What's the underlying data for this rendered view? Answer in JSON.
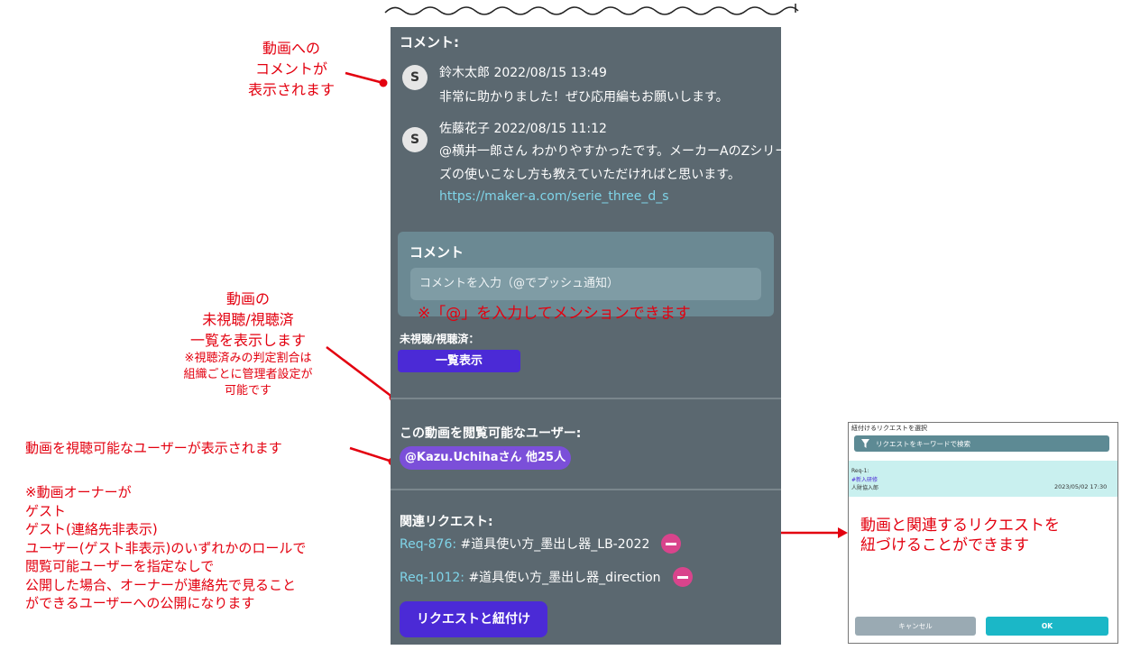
{
  "annotations": {
    "comments_note": [
      "動画への",
      "コメントが",
      "表示されます"
    ],
    "viewed_note": [
      "動画の",
      "未視聴/視聴済",
      "一覧を表示します"
    ],
    "viewed_subnote": [
      "※視聴済みの判定割合は",
      "組織ごとに管理者設定が",
      "可能です"
    ],
    "viewers_note": "動画を視聴可能なユーザーが表示されます",
    "owner_note": [
      "※動画オーナーが",
      "ゲスト",
      "ゲスト(連絡先非表示)",
      "ユーザー(ゲスト非表示)のいずれかのロールで",
      "閲覧可能ユーザーを指定なしで",
      "公開した場合、オーナーが連絡先で見ること",
      "ができるユーザーへの公開になります"
    ],
    "mention_note": "※「@」を入力してメンションできます",
    "link_note": [
      "動画と関連するリクエストを",
      "紐づけることができます"
    ]
  },
  "panel": {
    "comments_header": "コメント:",
    "comments": [
      {
        "avatar": "S",
        "author_time": "鈴木太郎 2022/08/15 13:49",
        "lines": [
          "非常に助かりました！ぜひ応用編もお願いします。"
        ],
        "link": ""
      },
      {
        "avatar": "S",
        "author_time": "佐藤花子 2022/08/15 11:12",
        "lines": [
          "@横井一郎さん わかりやすかったです。メーカーAのZシリー",
          "ズの使いこなし方も教えていただければと思います。"
        ],
        "link": "https://maker-a.com/serie_three_d_s"
      }
    ],
    "comment_box_title": "コメント",
    "comment_placeholder": "コメントを入力（@でプッシュ通知）",
    "viewed_label": "未視聴/視聴済：",
    "viewed_button": "一覧表示",
    "viewers_label": "この動画を閲覧可能なユーザー:",
    "viewers_pill": "@Kazu.Uchihaさん 他25人",
    "related_label": "関連リクエスト:",
    "requests": [
      {
        "id": "Req-876:",
        "title": "#道具使い方_墨出し器_LB-2022"
      },
      {
        "id": "Req-1012:",
        "title": "#道具使い方_墨出し器_direction"
      }
    ],
    "link_button": "リクエストと紐付け"
  },
  "dialog": {
    "title": "紐付けるリクエストを選択",
    "search_placeholder": "リクエストをキーワードで検索",
    "item": {
      "id": "Req-1:",
      "tag": "#新入研修",
      "user": "人財協入郎",
      "date": "2023/05/02 17:30"
    },
    "cancel": "キャンセル",
    "ok": "OK"
  },
  "colors": {
    "annotation": "#e3000f",
    "panel_bg": "#5b6870",
    "button_purple": "#4b2ad6",
    "link": "#7fd4e8",
    "dialog_accent": "#1bb7c7"
  },
  "icons": [
    "avatar-s",
    "minus-circle-icon",
    "filter-icon"
  ]
}
